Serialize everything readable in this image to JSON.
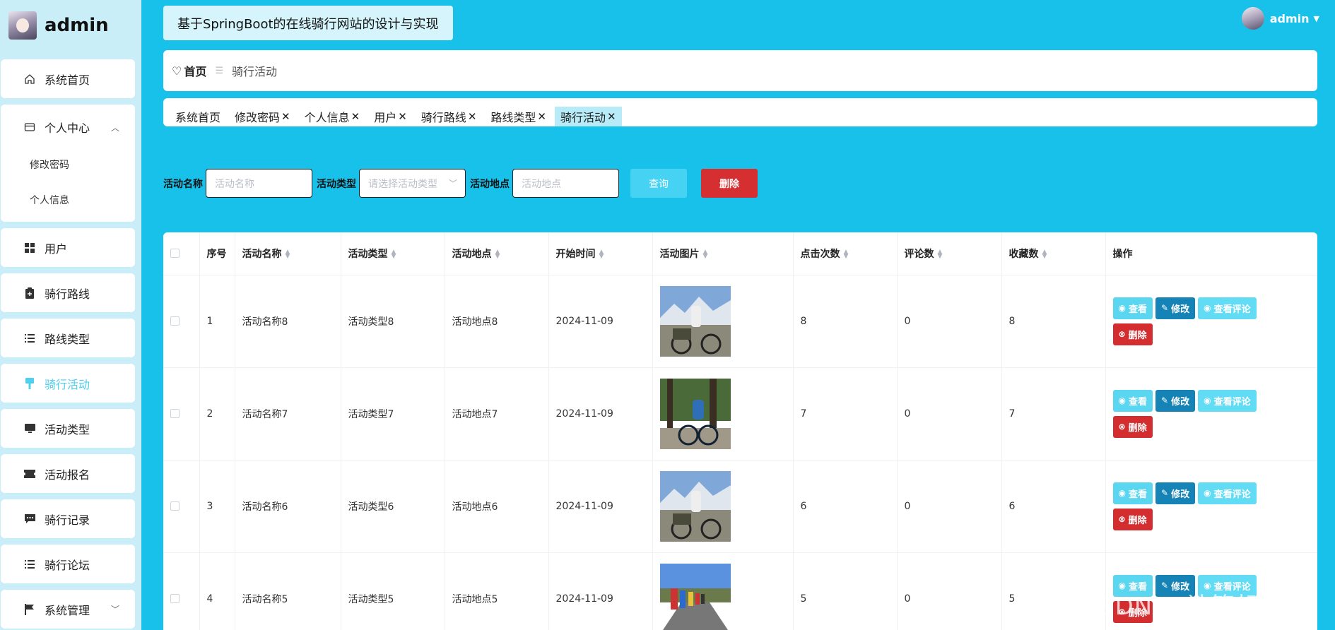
{
  "brand": {
    "title": "admin"
  },
  "sidebar": {
    "items": [
      {
        "label": "系统首页",
        "icon": "home-icon"
      },
      {
        "label": "个人中心",
        "icon": "card-icon",
        "expanded": true,
        "children": [
          "修改密码",
          "个人信息"
        ]
      },
      {
        "label": "用户",
        "icon": "grid-icon"
      },
      {
        "label": "骑行路线",
        "icon": "clipboard-icon"
      },
      {
        "label": "路线类型",
        "icon": "list-icon"
      },
      {
        "label": "骑行活动",
        "icon": "brush-icon",
        "active": true
      },
      {
        "label": "活动类型",
        "icon": "monitor-icon"
      },
      {
        "label": "活动报名",
        "icon": "ticket-icon"
      },
      {
        "label": "骑行记录",
        "icon": "chat-icon"
      },
      {
        "label": "骑行论坛",
        "icon": "list-icon"
      },
      {
        "label": "系统管理",
        "icon": "flag-icon",
        "collapsible": true
      }
    ]
  },
  "header": {
    "title": "基于SpringBoot的在线骑行网站的设计与实现",
    "user": "admin"
  },
  "breadcrumb": {
    "home": "首页",
    "current": "骑行活动"
  },
  "tags": [
    {
      "label": "系统首页",
      "closable": false
    },
    {
      "label": "修改密码",
      "closable": true
    },
    {
      "label": "个人信息",
      "closable": true
    },
    {
      "label": "用户",
      "closable": true
    },
    {
      "label": "骑行路线",
      "closable": true
    },
    {
      "label": "路线类型",
      "closable": true
    },
    {
      "label": "骑行活动",
      "closable": true,
      "active": true
    }
  ],
  "search": {
    "name_label": "活动名称",
    "name_placeholder": "活动名称",
    "type_label": "活动类型",
    "type_placeholder": "请选择活动类型",
    "place_label": "活动地点",
    "place_placeholder": "活动地点",
    "query_button": "查询",
    "delete_button": "删除"
  },
  "table": {
    "headers": [
      "序号",
      "活动名称",
      "活动类型",
      "活动地点",
      "开始时间",
      "活动图片",
      "点击次数",
      "评论数",
      "收藏数",
      "操作"
    ],
    "rows": [
      {
        "index": "1",
        "name": "活动名称8",
        "type": "活动类型8",
        "place": "活动地点8",
        "start": "2024-11-09",
        "clicks": "8",
        "comments": "0",
        "favorites": "8"
      },
      {
        "index": "2",
        "name": "活动名称7",
        "type": "活动类型7",
        "place": "活动地点7",
        "start": "2024-11-09",
        "clicks": "7",
        "comments": "0",
        "favorites": "7"
      },
      {
        "index": "3",
        "name": "活动名称6",
        "type": "活动类型6",
        "place": "活动地点6",
        "start": "2024-11-09",
        "clicks": "6",
        "comments": "0",
        "favorites": "6"
      },
      {
        "index": "4",
        "name": "活动名称5",
        "type": "活动类型5",
        "place": "活动地点5",
        "start": "2024-11-09",
        "clicks": "5",
        "comments": "0",
        "favorites": "5"
      }
    ],
    "actions": {
      "view": "查看",
      "edit": "修改",
      "comments": "查看评论",
      "delete": "删除"
    }
  },
  "watermark": "CSDN @计算机学姐",
  "colors": {
    "background": "#17c1ea",
    "sidebar": "#c9eef8",
    "active": "#4fd0ef",
    "danger": "#d62f32",
    "primary": "#1583b6"
  }
}
